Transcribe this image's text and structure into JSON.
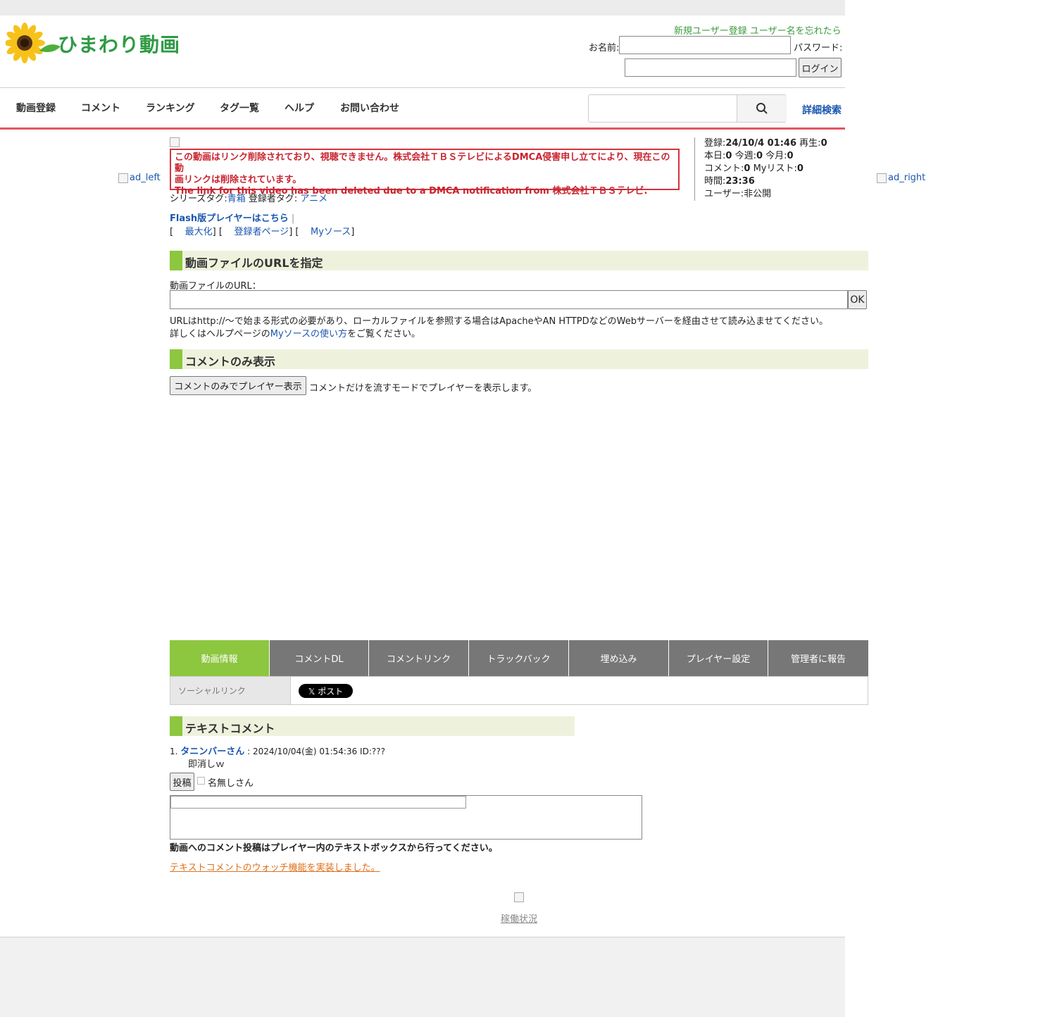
{
  "site": {
    "logo_text": "ひまわり動画"
  },
  "header": {
    "register_link": "新規ユーザー登録",
    "forgot_link": "ユーザー名を忘れたら",
    "name_label": "お名前:",
    "password_label": "パスワード:",
    "login_button": "ログイン"
  },
  "nav": {
    "items": [
      "動画登録",
      "コメント",
      "ランキング",
      "タグ一覧",
      "ヘルプ",
      "お問い合わせ"
    ],
    "advanced_search": "詳細検索"
  },
  "ads": {
    "left_alt": "ad_left",
    "right_alt": "ad_right"
  },
  "notice": {
    "line1": "この動画はリンク削除されており、視聴できません。株式会社ＴＢＳテレビによるDMCA侵害申し立てにより、現在この動",
    "line2": "画リンクは削除されています。",
    "line3": "The link for this video has been deleted due to a DMCA notification from 株式会社ＴＢＳテレビ."
  },
  "tags": {
    "series_label": "シリーズタグ:",
    "series_value": "青箱",
    "registrant_label": "登録者タグ:",
    "registrant_value": "アニメ"
  },
  "player_links": {
    "flash": "Flash版プレイヤーはこちら",
    "sep": "|",
    "maximize": "最大化",
    "uploader_page": "登録者ページ",
    "my_source": "Myソース"
  },
  "stats": {
    "registered_label": "登録:",
    "registered_value": "24/10/4 01:46",
    "plays_label": "再生:",
    "plays_value": "0",
    "today_label": "本日:",
    "today_value": "0",
    "week_label": "今週:",
    "week_value": "0",
    "month_label": "今月:",
    "month_value": "0",
    "comments_label": "コメント:",
    "comments_value": "0",
    "mylist_label": "Myリスト:",
    "mylist_value": "0",
    "duration_label": "時間:",
    "duration_value": "23:36",
    "user_label": "ユーザー:非公開"
  },
  "url_section": {
    "title": "動画ファイルのURLを指定",
    "field_label": "動画ファイルのURL：",
    "ok_button": "OK",
    "help1": "URLはhttp://〜で始まる形式の必要があり、ローカルファイルを参照する場合はApacheやAN HTTPDなどのWebサーバーを経由させて読み込ませてください。",
    "help2_pre": "詳しくはヘルプページの",
    "help2_link": "Myソースの使い方",
    "help2_post": "をご覧ください。"
  },
  "comment_only": {
    "title": "コメントのみ表示",
    "button": "コメントのみでプレイヤー表示",
    "desc": "コメントだけを流すモードでプレイヤーを表示します。"
  },
  "tabs": [
    "動画情報",
    "コメントDL",
    "コメントリンク",
    "トラックバック",
    "埋め込み",
    "プレイヤー設定",
    "管理者に報告"
  ],
  "social": {
    "label": "ソーシャルリンク",
    "x_post": "𝕏 ポスト"
  },
  "text_comments": {
    "title": "テキストコメント",
    "items": [
      {
        "num": "1.",
        "author": "タニンバーさん",
        "meta": ": 2024/10/04(金) 01:54:36 ID:???",
        "body": "即消しｗ"
      }
    ],
    "post_button": "投稿",
    "anon_label": "名無しさん",
    "notice": "動画へのコメント投稿はプレイヤー内のテキストボックスから行ってください。",
    "watch_link": "テキストコメントのウォッチ機能を実装しました。"
  },
  "footer": {
    "status_link": "稼働状況"
  },
  "colors": {
    "accent_green": "#8dc63f",
    "nav_underline": "#e35564",
    "notice_red": "#c8242f",
    "link_blue": "#1a56b0"
  }
}
